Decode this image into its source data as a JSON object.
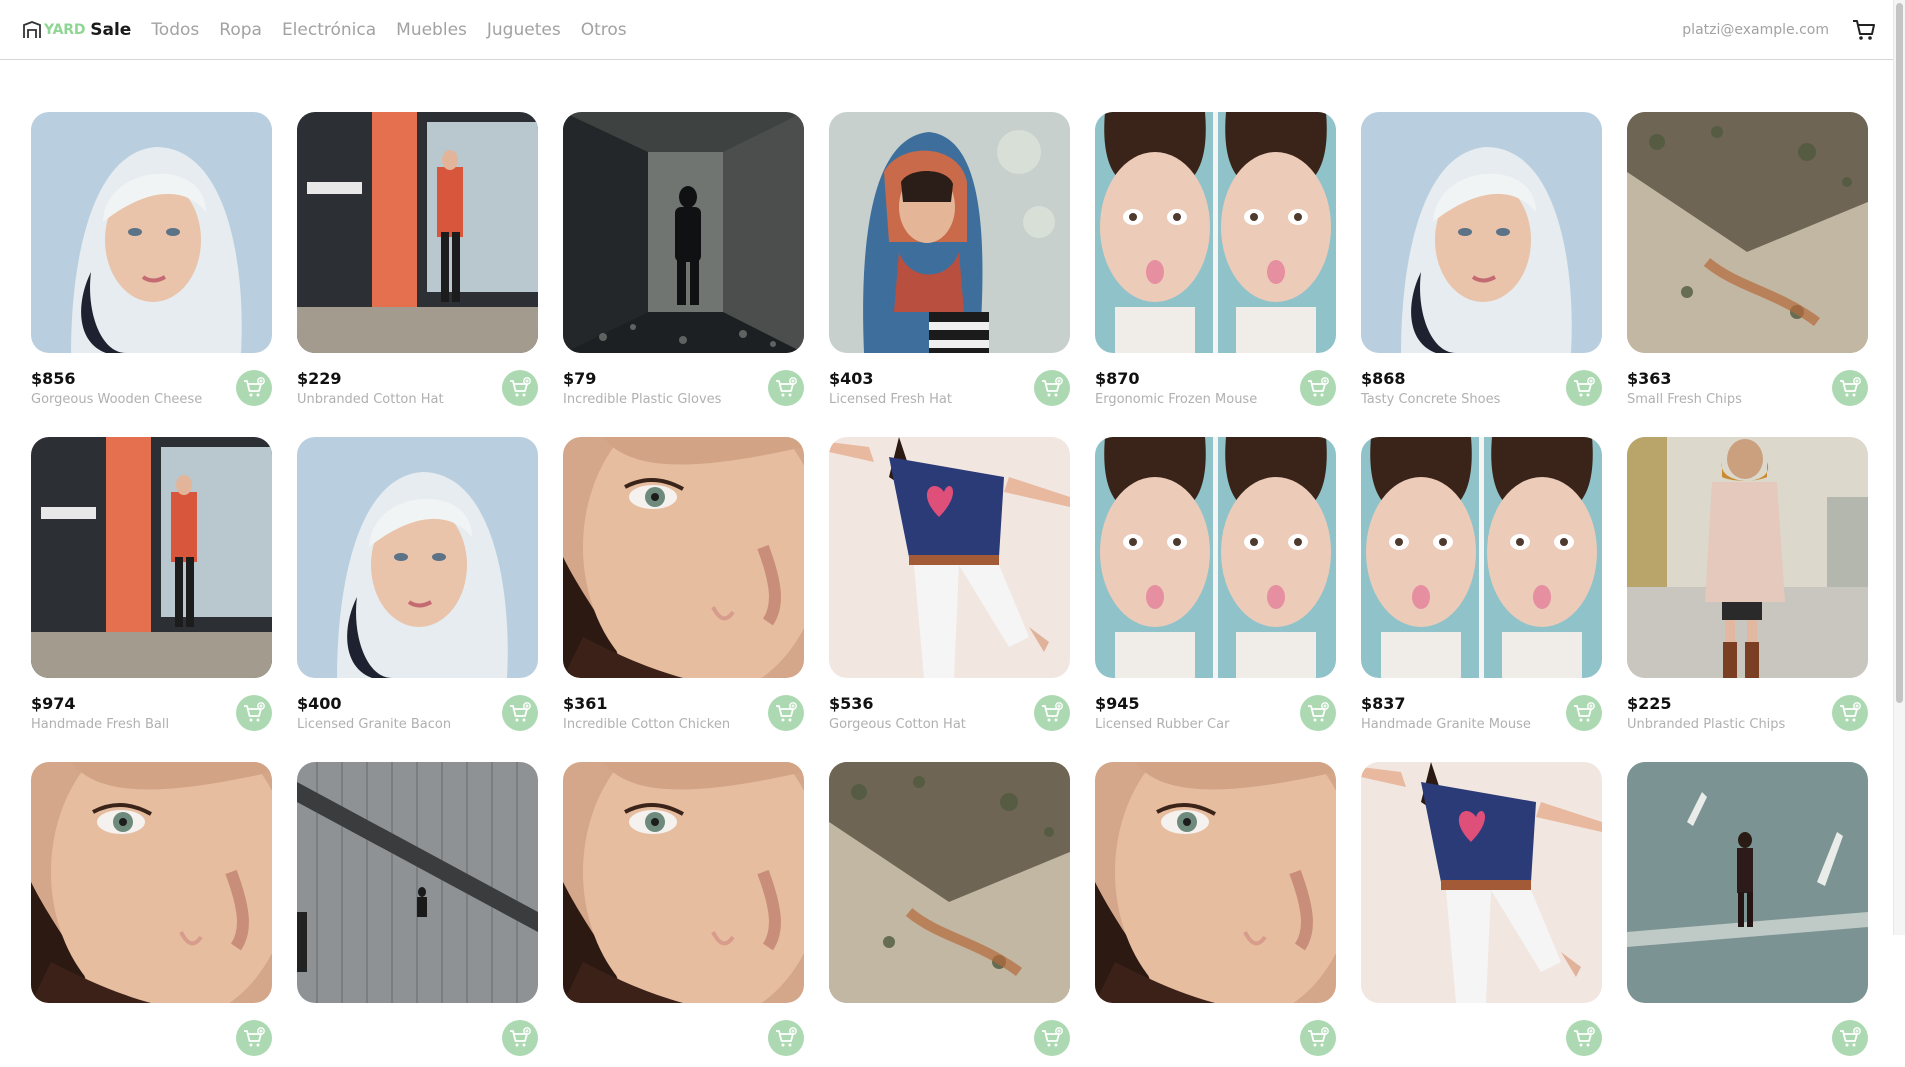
{
  "nav": {
    "logo_yard": "YARD",
    "logo_sale": "Sale",
    "logo_icon": "shop-icon",
    "links": [
      "Todos",
      "Ropa",
      "Electrónica",
      "Muebles",
      "Juguetes",
      "Otros"
    ],
    "email": "platzi@example.com",
    "cart_icon": "cart-icon"
  },
  "colors": {
    "accent": "#acd9b2",
    "logo_green": "#8fd694",
    "muted_text": "#b0b0b0",
    "nav_text": "#a2a2a2"
  },
  "products": [
    {
      "price": "$856",
      "name": "Gorgeous Wooden Cheese",
      "image": "blonde-woman-portrait"
    },
    {
      "price": "$229",
      "name": "Unbranded Cotton Hat",
      "image": "woman-orange-wall"
    },
    {
      "price": "$79",
      "name": "Incredible Plastic Gloves",
      "image": "dark-figure-corridor"
    },
    {
      "price": "$403",
      "name": "Licensed Fresh Hat",
      "image": "woman-scarf-hood"
    },
    {
      "price": "$870",
      "name": "Ergonomic Frozen Mouse",
      "image": "woman-duck-face-split"
    },
    {
      "price": "$868",
      "name": "Tasty Concrete Shoes",
      "image": "blonde-woman-portrait"
    },
    {
      "price": "$363",
      "name": "Small Fresh Chips",
      "image": "rock-moss-texture"
    },
    {
      "price": "$974",
      "name": "Handmade Fresh Ball",
      "image": "woman-orange-wall"
    },
    {
      "price": "$400",
      "name": "Licensed Granite Bacon",
      "image": "blonde-woman-portrait"
    },
    {
      "price": "$361",
      "name": "Incredible Cotton Chicken",
      "image": "woman-face-closeup"
    },
    {
      "price": "$536",
      "name": "Gorgeous Cotton Hat",
      "image": "woman-jumping-heart-shirt"
    },
    {
      "price": "$945",
      "name": "Licensed Rubber Car",
      "image": "woman-duck-face-split"
    },
    {
      "price": "$837",
      "name": "Handmade Granite Mouse",
      "image": "woman-duck-face-split"
    },
    {
      "price": "$225",
      "name": "Unbranded Plastic Chips",
      "image": "woman-coat-street"
    },
    {
      "price": "",
      "name": "",
      "image": "woman-face-closeup"
    },
    {
      "price": "",
      "name": "",
      "image": "man-walking-wall"
    },
    {
      "price": "",
      "name": "",
      "image": "woman-face-closeup"
    },
    {
      "price": "",
      "name": "",
      "image": "rock-moss-texture"
    },
    {
      "price": "",
      "name": "",
      "image": "woman-face-closeup"
    },
    {
      "price": "",
      "name": "",
      "image": "woman-jumping-heart-shirt"
    },
    {
      "price": "",
      "name": "",
      "image": "man-crosswalk"
    }
  ]
}
